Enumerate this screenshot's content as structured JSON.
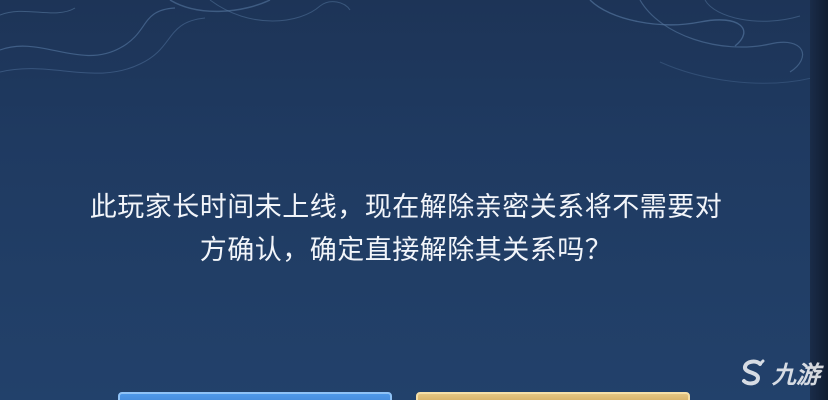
{
  "dialog": {
    "message_line1": "此玩家长时间未上线，现在解除亲密关系将不需要对",
    "message_line2": "方确认，确定直接解除其关系吗？",
    "confirm_button_label": "",
    "cancel_button_label": ""
  },
  "watermark": {
    "text": "九游",
    "icon": "s-logo-icon"
  },
  "colors": {
    "background": "#1f3a61",
    "text": "#f2f5fa",
    "blue_button": "#4f98e8",
    "gold_button": "#e5c581"
  }
}
